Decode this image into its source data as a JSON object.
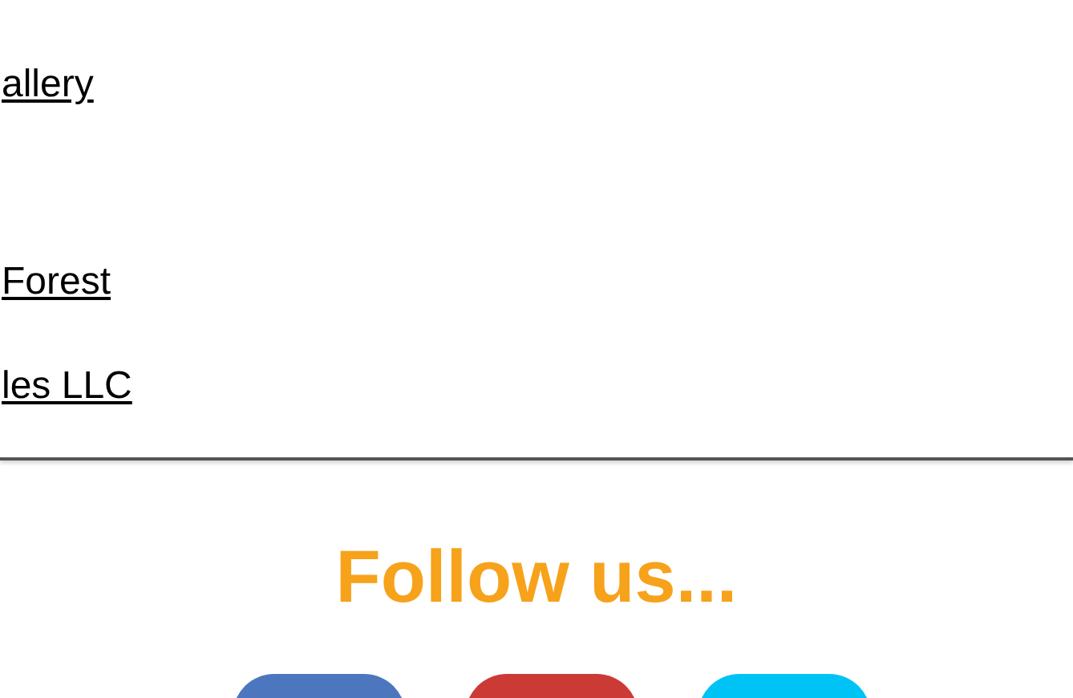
{
  "links": [
    {
      "label": "allery"
    },
    {
      "label": "Forest"
    },
    {
      "label": "les LLC"
    }
  ],
  "follow": {
    "heading": "Follow us...",
    "social_buttons": [
      {
        "color": "#4c77bf"
      },
      {
        "color": "#cc3a35"
      },
      {
        "color": "#00c3f5"
      }
    ]
  }
}
